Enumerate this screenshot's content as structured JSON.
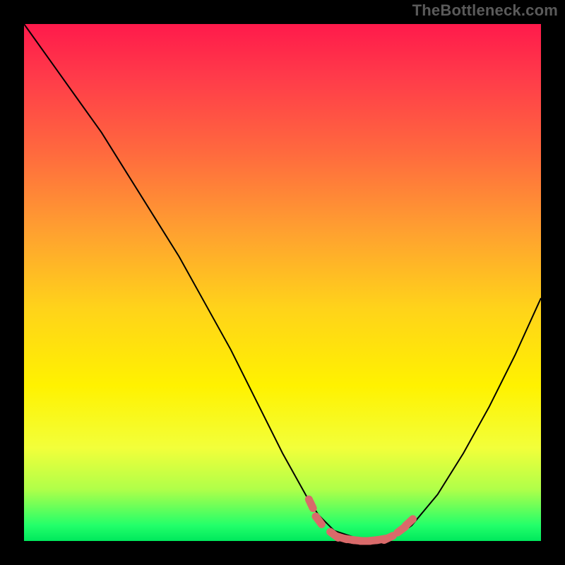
{
  "watermark": "TheBottleneck.com",
  "colors": {
    "curve_stroke": "#000000",
    "marker_stroke": "#d96a6a",
    "marker_fill": "#d96a6a",
    "background": "#000000"
  },
  "chart_data": {
    "type": "line",
    "title": "",
    "xlabel": "",
    "ylabel": "",
    "xlim": [
      0,
      100
    ],
    "ylim": [
      0,
      100
    ],
    "series": [
      {
        "name": "curve",
        "x": [
          0,
          5,
          10,
          15,
          20,
          25,
          30,
          35,
          40,
          45,
          50,
          55,
          57,
          60,
          63,
          66,
          70,
          72,
          75,
          80,
          85,
          90,
          95,
          100
        ],
        "y": [
          100,
          93,
          86,
          79,
          71,
          63,
          55,
          46,
          37,
          27,
          17,
          8,
          5,
          2,
          1,
          0,
          0,
          1,
          3,
          9,
          17,
          26,
          36,
          47
        ]
      }
    ],
    "markers": [
      {
        "x": 55.5,
        "y": 7.2
      },
      {
        "x": 57.0,
        "y": 4.0
      },
      {
        "x": 60.0,
        "y": 1.2
      },
      {
        "x": 61.5,
        "y": 0.6
      },
      {
        "x": 63.0,
        "y": 0.3
      },
      {
        "x": 64.5,
        "y": 0.1
      },
      {
        "x": 66.0,
        "y": 0.0
      },
      {
        "x": 67.5,
        "y": 0.1
      },
      {
        "x": 69.0,
        "y": 0.3
      },
      {
        "x": 70.5,
        "y": 0.6
      },
      {
        "x": 73.0,
        "y": 2.2
      },
      {
        "x": 74.5,
        "y": 3.6
      }
    ],
    "gradient_stops": [
      {
        "pos": 0.0,
        "color": "#ff1a4b"
      },
      {
        "pos": 0.25,
        "color": "#ff6a3e"
      },
      {
        "pos": 0.55,
        "color": "#ffd31a"
      },
      {
        "pos": 0.82,
        "color": "#f2ff3a"
      },
      {
        "pos": 1.0,
        "color": "#00e85c"
      }
    ]
  }
}
